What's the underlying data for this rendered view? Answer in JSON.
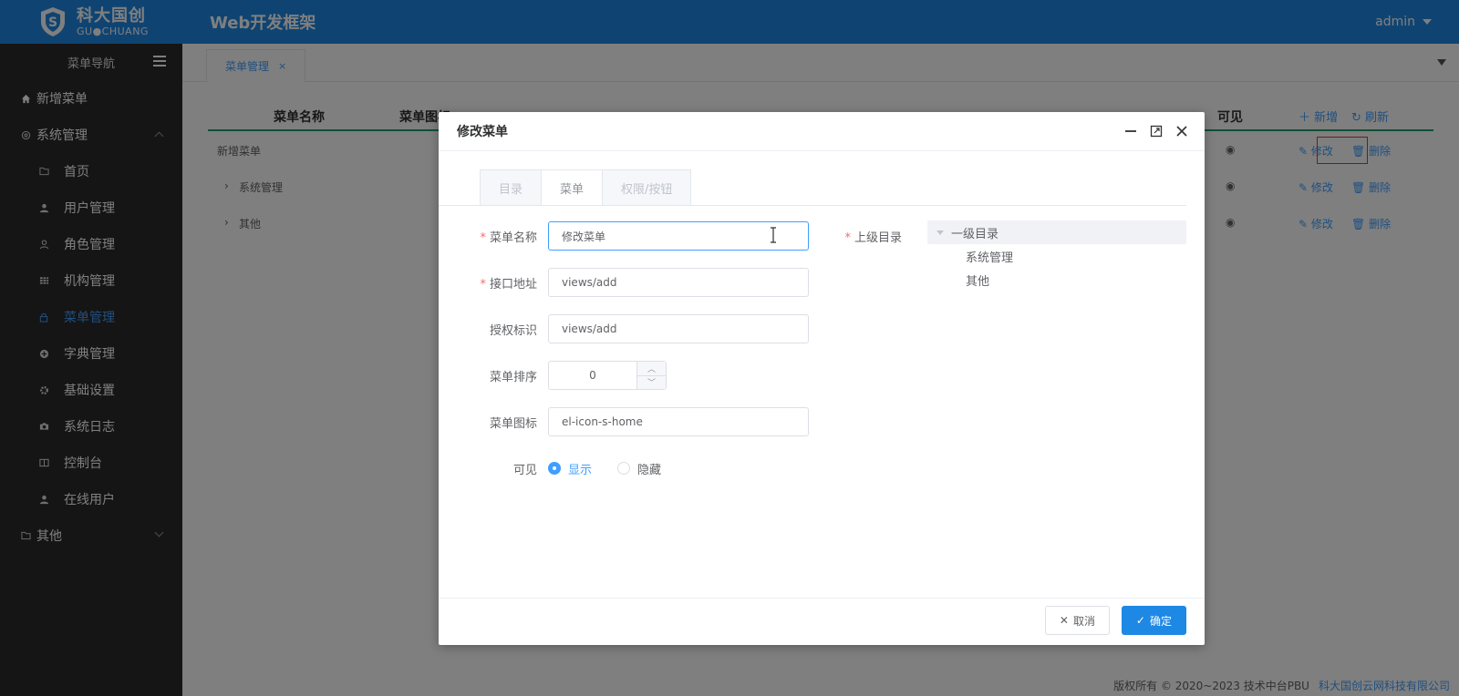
{
  "header": {
    "logo_cn": "科大国创",
    "logo_en": "GU●CHUANG",
    "app_title": "Web开发框架",
    "user": "admin"
  },
  "sidebar": {
    "title": "菜单导航",
    "items": [
      {
        "label": "新增菜单",
        "icon": "home-icon"
      },
      {
        "label": "系统管理",
        "icon": "gear-icon"
      },
      {
        "label": "首页",
        "icon": "folder-icon"
      },
      {
        "label": "用户管理",
        "icon": "user-icon"
      },
      {
        "label": "角色管理",
        "icon": "user-outline-icon"
      },
      {
        "label": "机构管理",
        "icon": "grid-icon"
      },
      {
        "label": "菜单管理",
        "icon": "lock-icon"
      },
      {
        "label": "字典管理",
        "icon": "plus-circle-icon"
      },
      {
        "label": "基础设置",
        "icon": "gear-icon"
      },
      {
        "label": "系统日志",
        "icon": "camera-icon"
      },
      {
        "label": "控制台",
        "icon": "panel-icon"
      },
      {
        "label": "在线用户",
        "icon": "user-icon"
      },
      {
        "label": "其他",
        "icon": "folder-icon"
      }
    ]
  },
  "tabs": {
    "active_tab": "菜单管理",
    "close": "×"
  },
  "table": {
    "headers": [
      "菜单名称",
      "菜单图标",
      "可见"
    ],
    "add_label": "新增",
    "refresh_label": "刷新",
    "rows": [
      {
        "name": "新增菜单",
        "edit": "修改",
        "delete": "删除"
      },
      {
        "name": "系统管理",
        "edit": "修改",
        "delete": "删除"
      },
      {
        "name": "其他",
        "edit": "修改",
        "delete": "删除"
      }
    ]
  },
  "dialog": {
    "title": "修改菜单",
    "type_tabs": [
      "目录",
      "菜单",
      "权限/按钮"
    ],
    "fields": {
      "name_label": "菜单名称",
      "name_value": "修改菜单",
      "api_label": "接口地址",
      "api_value": "views/add",
      "perm_label": "授权标识",
      "perm_value": "views/add",
      "order_label": "菜单排序",
      "order_value": "0",
      "icon_label": "菜单图标",
      "icon_value": "el-icon-s-home",
      "visible_label": "可见",
      "visible_show": "显示",
      "visible_hide": "隐藏",
      "parent_label": "上级目录"
    },
    "tree": {
      "root": "一级目录",
      "children": [
        "系统管理",
        "其他"
      ]
    },
    "cancel_label": "取消",
    "ok_label": "确定"
  },
  "footer": {
    "copyright": "版权所有 © 2020~2023 技术中台PBU",
    "company": "科大国创云网科技有限公司"
  },
  "colors": {
    "primary": "#1e88e5",
    "accent": "#409eff",
    "sidebar_bg": "#2b2b2b",
    "danger": "#e53935"
  }
}
